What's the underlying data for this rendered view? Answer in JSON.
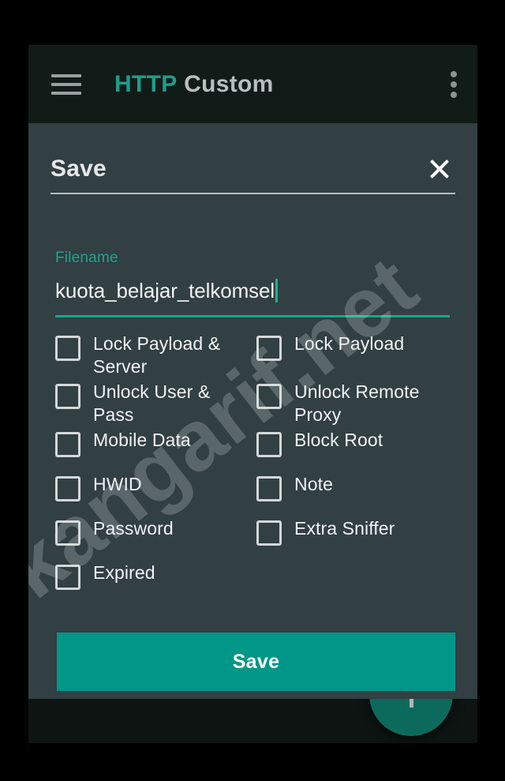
{
  "app": {
    "bar": {
      "menu_icon": "hamburger-menu-icon",
      "title_primary": "HTTP",
      "title_secondary": "Custom",
      "overflow_icon": "overflow-menu-icon"
    },
    "fab": {
      "icon": "plus-icon",
      "label": "+"
    }
  },
  "dialog": {
    "title": "Save",
    "close_icon": "close-icon",
    "field": {
      "label": "Filename",
      "value": "kuota_belajar_telkomsel",
      "placeholder": "Filename"
    },
    "options": [
      {
        "label": "Lock Payload & Server",
        "checked": false
      },
      {
        "label": "Lock Payload",
        "checked": false
      },
      {
        "label": "Unlock User & Pass",
        "checked": false
      },
      {
        "label": "Unlock Remote Proxy",
        "checked": false
      },
      {
        "label": "Mobile Data",
        "checked": false
      },
      {
        "label": "Block Root",
        "checked": false
      },
      {
        "label": "HWID",
        "checked": false
      },
      {
        "label": "Note",
        "checked": false
      },
      {
        "label": "Password",
        "checked": false
      },
      {
        "label": "Extra Sniffer",
        "checked": false
      },
      {
        "label": "Expired",
        "checked": false
      }
    ],
    "save_button": "Save"
  },
  "watermark": {
    "text": "kangarif.net"
  },
  "colors": {
    "accent_teal": "#009688",
    "label_teal": "#1fa38d",
    "dialog_bg": "#323f43",
    "appbar_bg": "#111b18",
    "page_bg": "#0d1412",
    "fab_bg": "#0c6a5c",
    "text_primary": "#f0f3f3"
  }
}
